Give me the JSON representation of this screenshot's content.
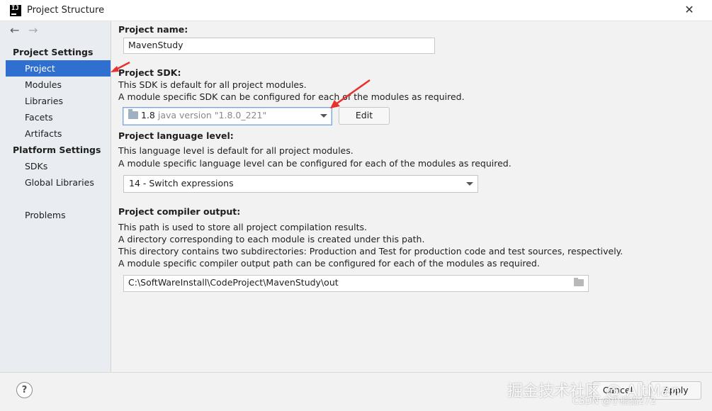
{
  "window": {
    "title": "Project Structure",
    "close_glyph": "✕",
    "app_icon_text": "IJ"
  },
  "nav": {
    "back_glyph": "←",
    "forward_glyph": "→"
  },
  "sidebar": {
    "project_settings_header": "Project Settings",
    "project_settings_items": [
      {
        "label": "Project",
        "selected": true
      },
      {
        "label": "Modules",
        "selected": false
      },
      {
        "label": "Libraries",
        "selected": false
      },
      {
        "label": "Facets",
        "selected": false
      },
      {
        "label": "Artifacts",
        "selected": false
      }
    ],
    "platform_settings_header": "Platform Settings",
    "platform_settings_items": [
      {
        "label": "SDKs"
      },
      {
        "label": "Global Libraries"
      }
    ],
    "problems_label": "Problems"
  },
  "project_name": {
    "label": "Project name:",
    "value": "MavenStudy"
  },
  "project_sdk": {
    "label": "Project SDK:",
    "desc_1": "This SDK is default for all project modules.",
    "desc_2": "A module specific SDK can be configured for each of the modules as required.",
    "selected_version": "1.8",
    "selected_detail": "java version \"1.8.0_221\"",
    "edit_button": "Edit"
  },
  "language_level": {
    "label": "Project language level:",
    "desc_1": "This language level is default for all project modules.",
    "desc_2": "A module specific language level can be configured for each of the modules as required.",
    "selected": "14 - Switch expressions"
  },
  "compiler_output": {
    "label": "Project compiler output:",
    "desc_1": "This path is used to store all project compilation results.",
    "desc_2": "A directory corresponding to each module is created under this path.",
    "desc_3": "This directory contains two subdirectories: Production and Test for production code and test sources, respectively.",
    "desc_4": "A module specific compiler output path can be configured for each of the modules as required.",
    "path": "C:\\SoftWareInstall\\CodeProject\\MavenStudy\\out"
  },
  "footer": {
    "help_glyph": "?",
    "cancel_button": "Cancel",
    "apply_button": "Apply",
    "watermark_1": "掘金技术社区 @ AltMan",
    "watermark_2": "CSDN @小熊猫272"
  },
  "colors": {
    "selection": "#2f6fcf",
    "annotation_arrow": "#e8302c",
    "sidebar_bg": "#e9ecf1",
    "content_bg": "#f2f2f2"
  }
}
